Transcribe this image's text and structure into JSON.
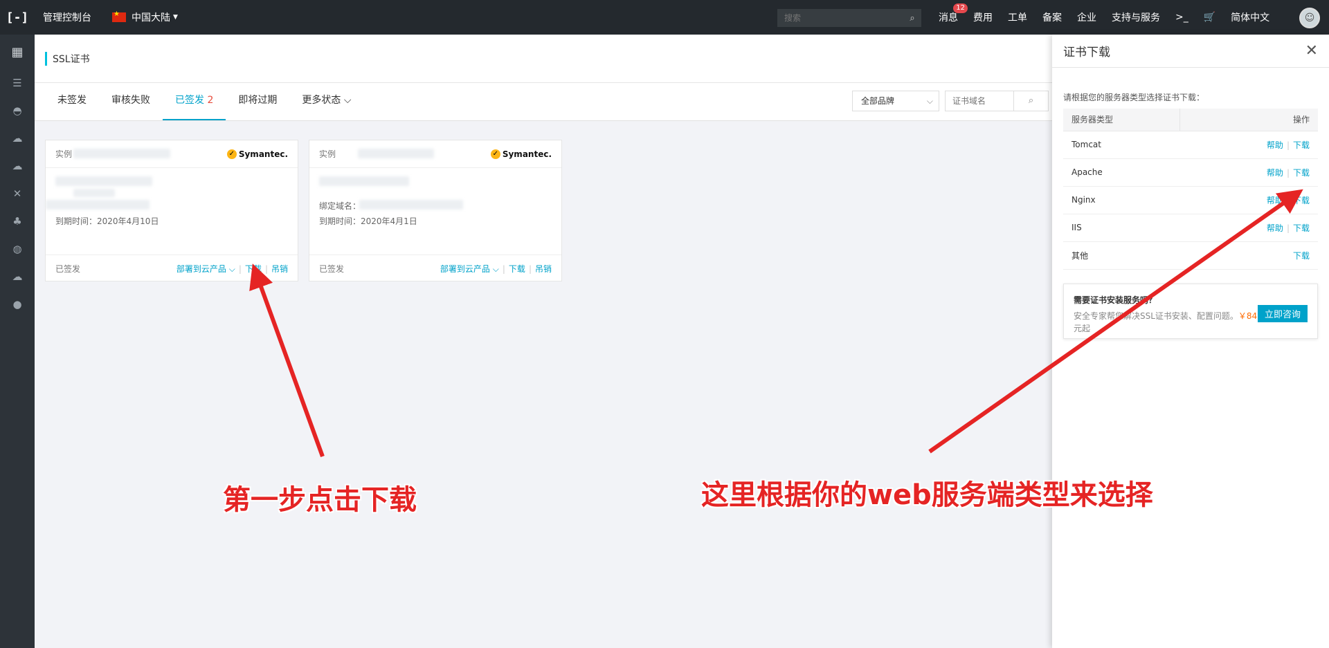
{
  "topbar": {
    "logo": "[-]",
    "console_title": "管理控制台",
    "region": "中国大陆",
    "search_placeholder": "搜索",
    "nav": {
      "messages": "消息",
      "messages_badge": "12",
      "billing": "费用",
      "tickets": "工单",
      "icp": "备案",
      "enterprise": "企业",
      "support": "支持与服务",
      "language": "简体中文"
    }
  },
  "page": {
    "title": "SSL证书",
    "tabs": [
      {
        "label": "未签发"
      },
      {
        "label": "审核失败"
      },
      {
        "label": "已签发",
        "count": "2"
      },
      {
        "label": "即将过期"
      },
      {
        "label": "更多状态"
      }
    ],
    "brand_select": "全部品牌",
    "domain_placeholder": "证书域名"
  },
  "cards": [
    {
      "head": "实例",
      "brand": "Symantec.",
      "bound_domain_label": "",
      "expiry": "到期时间：2020年4月10日",
      "status": "已签发",
      "deploy": "部署到云产品",
      "download": "下载",
      "revoke": "吊销"
    },
    {
      "head": "实例",
      "brand": "Symantec.",
      "bound_domain_label": "绑定域名：",
      "expiry": "到期时间：2020年4月1日",
      "status": "已签发",
      "deploy": "部署到云产品",
      "download": "下载",
      "revoke": "吊销"
    }
  ],
  "drawer": {
    "title": "证书下载",
    "tip": "请根据您的服务器类型选择证书下载：",
    "col_type": "服务器类型",
    "col_op": "操作",
    "help": "帮助",
    "download": "下载",
    "servers": [
      "Tomcat",
      "Apache",
      "Nginx",
      "IIS",
      "其他"
    ],
    "consult_title": "需要证书安装服务吗？",
    "consult_desc": "安全专家帮您解决SSL证书安装、配置问题。",
    "consult_price": "￥84",
    "consult_suffix": "元起",
    "consult_button": "立即咨询"
  },
  "annotations": {
    "step1": "第一步点击下载",
    "step2": "这里根据你的web服务端类型来选择"
  },
  "colors": {
    "accent": "#00a2ca",
    "arrow": "#e52424",
    "topbar": "#24292e"
  }
}
